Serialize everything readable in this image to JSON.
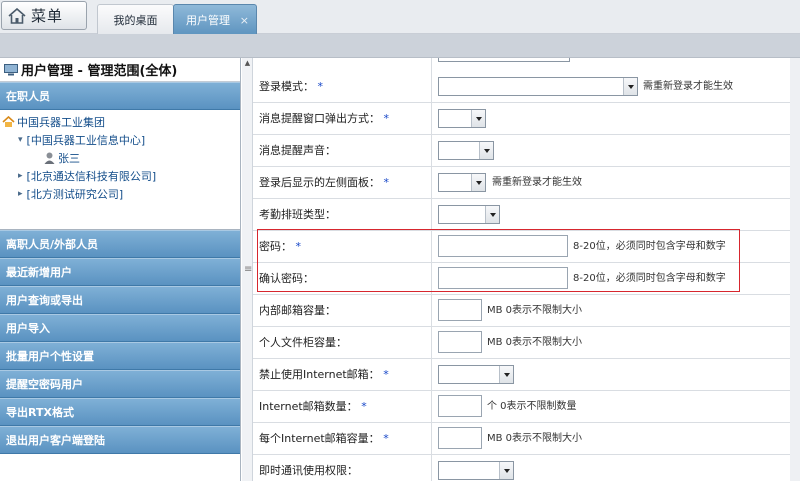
{
  "header": {
    "menu_label": "菜单",
    "tabs": [
      {
        "label": "我的桌面"
      },
      {
        "label": "用户管理",
        "close": "×"
      }
    ]
  },
  "sidebar": {
    "title": "用户管理 - 管理范围(全体)",
    "active_section": "在职人员",
    "tree": [
      {
        "label": "中国兵器工业集团"
      },
      {
        "label": "[中国兵器工业信息中心]",
        "toggle": "▾"
      },
      {
        "label": "张三"
      },
      {
        "label": "[北京通达信科技有限公司]",
        "toggle": "▸"
      },
      {
        "label": "[北方测试研究公司]",
        "toggle": "▸"
      }
    ],
    "items": [
      {
        "label": "离职人员/外部人员"
      },
      {
        "label": "最近新增用户"
      },
      {
        "label": "用户查询或导出"
      },
      {
        "label": "用户导入"
      },
      {
        "label": "批量用户个性设置"
      },
      {
        "label": "提醒空密码用户"
      },
      {
        "label": "导出RTX格式"
      },
      {
        "label": "退出用户客户端登陆"
      }
    ]
  },
  "form": {
    "rows": [
      {
        "label": "登录模式：",
        "required": "*",
        "hint": "需重新登录才能生效"
      },
      {
        "label": "消息提醒窗口弹出方式：",
        "required": "*"
      },
      {
        "label": "消息提醒声音：",
        "required": ""
      },
      {
        "label": "登录后显示的左侧面板：",
        "required": "*",
        "hint": "需重新登录才能生效"
      },
      {
        "label": "考勤排班类型：",
        "required": ""
      },
      {
        "label": "密码：",
        "required": "*",
        "hint": "8-20位，必须同时包含字母和数字"
      },
      {
        "label": "确认密码：",
        "required": "",
        "hint": "8-20位，必须同时包含字母和数字"
      },
      {
        "label": "内部邮箱容量：",
        "required": "",
        "hint": "MB 0表示不限制大小"
      },
      {
        "label": "个人文件柜容量：",
        "required": "",
        "hint": "MB 0表示不限制大小"
      },
      {
        "label": "禁止使用Internet邮箱：",
        "required": "*"
      },
      {
        "label": "Internet邮箱数量：",
        "required": "*",
        "hint": "个 0表示不限制数量"
      },
      {
        "label": "每个Internet邮箱容量：",
        "required": "*",
        "hint": "MB 0表示不限制大小"
      },
      {
        "label": "即时通讯使用权限：",
        "required": ""
      }
    ]
  },
  "colors": {
    "accent": "#5a92c1",
    "required": "#1646c8",
    "highlight_border": "#d7262e"
  }
}
